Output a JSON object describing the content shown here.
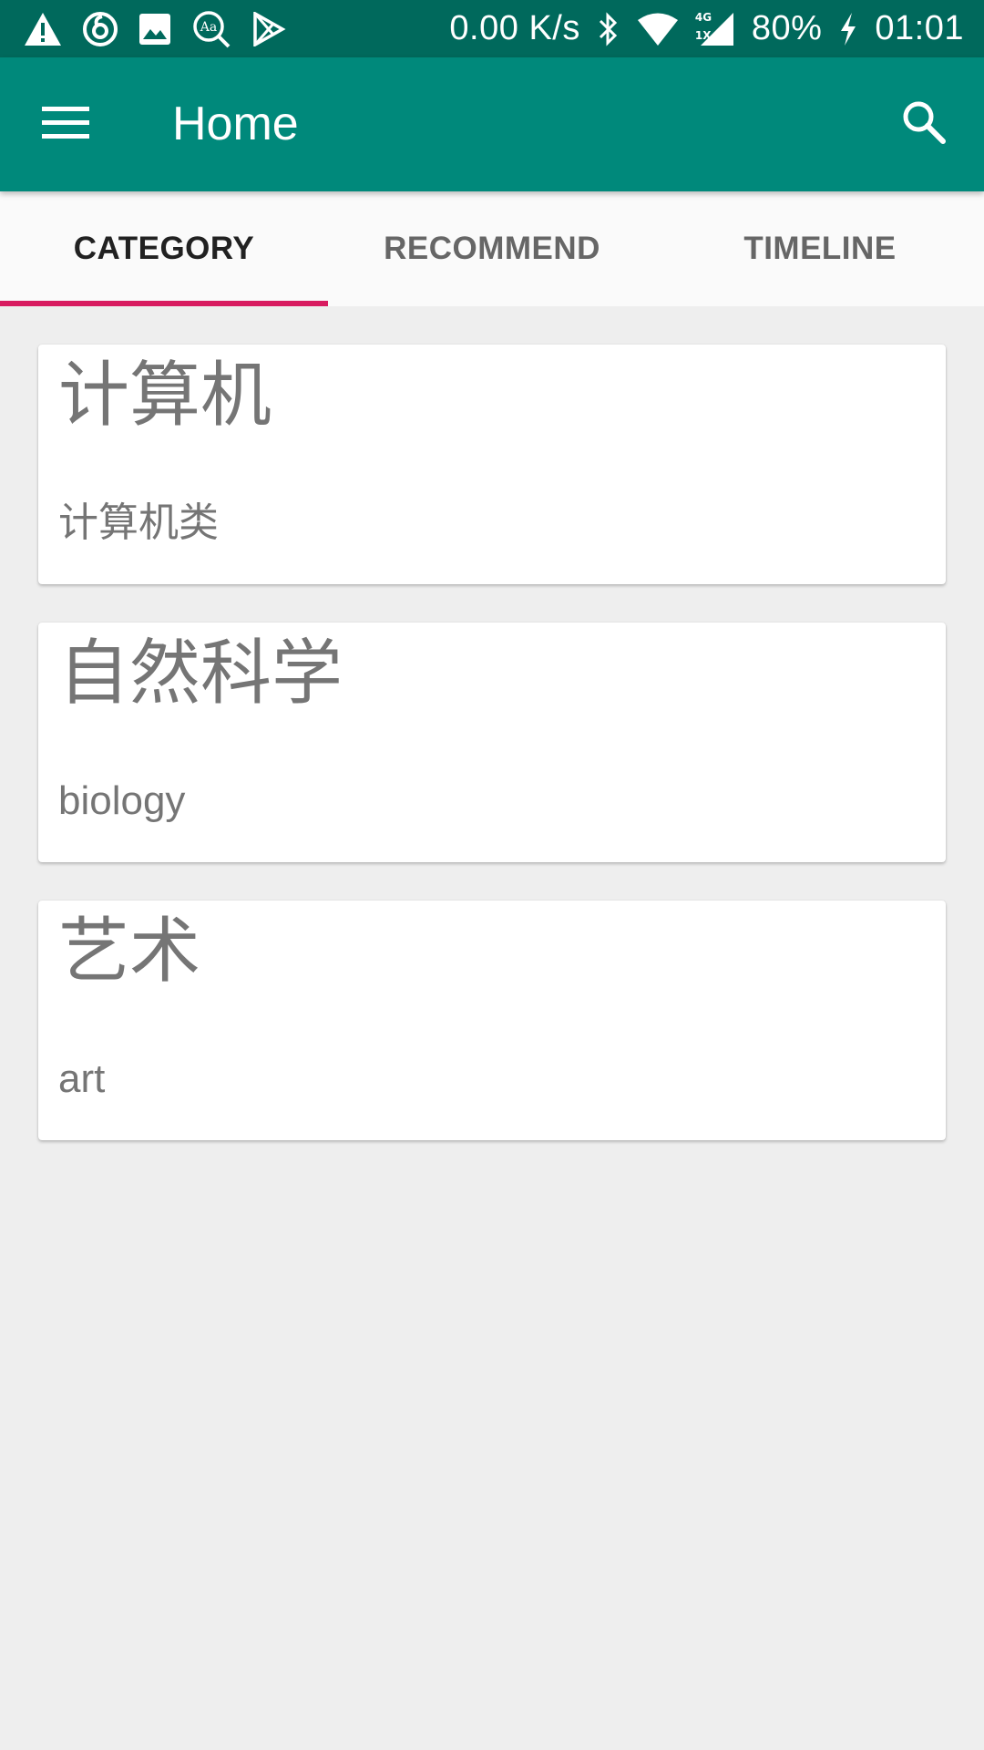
{
  "status_bar": {
    "network_speed": "0.00 K/s",
    "signal_label_top": "4G",
    "signal_label_bottom": "1X",
    "battery": "80%",
    "time": "01:01",
    "left_icons": [
      "warning-icon",
      "netease-music-icon",
      "image-icon",
      "dictionary-icon",
      "play-store-icon"
    ],
    "right_icons": [
      "bluetooth-icon",
      "wifi-icon",
      "cell-signal-icon",
      "charging-icon"
    ]
  },
  "app_bar": {
    "title": "Home",
    "menu_icon": "menu-icon",
    "search_icon": "search-icon",
    "background": "#00897b",
    "status_background": "#00695c"
  },
  "tabs": [
    {
      "label": "CATEGORY",
      "active": true
    },
    {
      "label": "RECOMMEND",
      "active": false
    },
    {
      "label": "TIMELINE",
      "active": false
    }
  ],
  "tab_indicator_color": "#d81b60",
  "categories": [
    {
      "title": "计算机",
      "subtitle": "计算机类"
    },
    {
      "title": "自然科学",
      "subtitle": "biology"
    },
    {
      "title": "艺术",
      "subtitle": "art"
    }
  ]
}
